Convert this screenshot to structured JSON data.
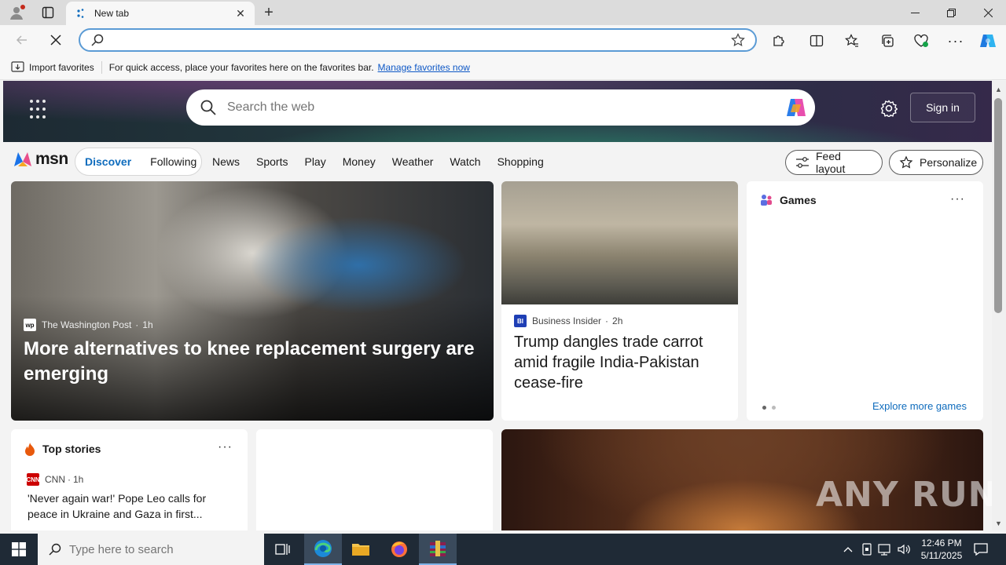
{
  "browser": {
    "tab": {
      "title": "New tab"
    },
    "address": {
      "value": "",
      "placeholder": ""
    },
    "favorites_bar": {
      "import_label": "Import favorites",
      "message": "For quick access, place your favorites here on the favorites bar.",
      "link": "Manage favorites now"
    },
    "accent_color": "#0f6cbd"
  },
  "msn": {
    "search_placeholder": "Search the web",
    "sign_in": "Sign in",
    "logo_text": "msn",
    "pills": [
      "Discover",
      "Following"
    ],
    "nav": [
      "News",
      "Sports",
      "Play",
      "Money",
      "Weather",
      "Watch",
      "Shopping"
    ],
    "feed_layout": "Feed layout",
    "personalize": "Personalize",
    "hero": {
      "source": "The Washington Post",
      "age": "1h",
      "headline": "More alternatives to knee replacement surgery are emerging"
    },
    "bi": {
      "source": "Business Insider",
      "age": "2h",
      "headline": "Trump dangles trade carrot amid fragile India-Pakistan cease-fire"
    },
    "games": {
      "title": "Games",
      "explore": "Explore more games"
    },
    "top_stories": {
      "title": "Top stories",
      "source": "CNN",
      "age": "1h",
      "headline": "'Never again war!' Pope Leo calls for peace in Ukraine and Gaza in first..."
    }
  },
  "watermark": "ANY RUN",
  "taskbar": {
    "search_placeholder": "Type here to search",
    "time": "12:46 PM",
    "date": "5/11/2025"
  }
}
